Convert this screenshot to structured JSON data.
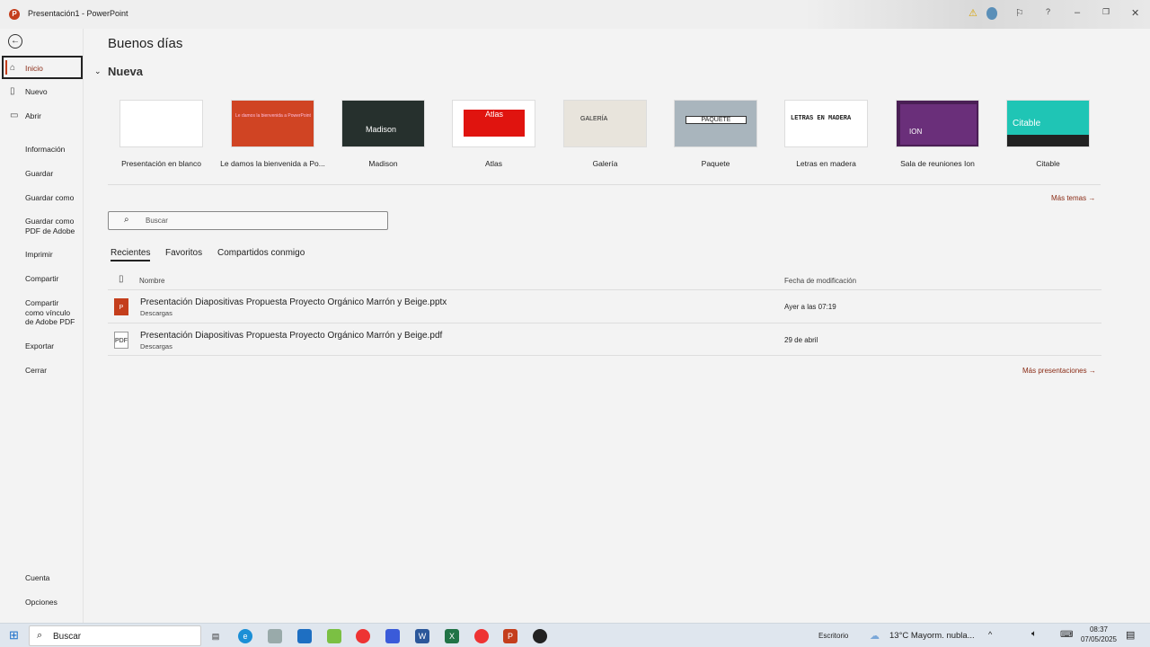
{
  "window": {
    "title": "Presentación1  -  PowerPoint"
  },
  "sidebar": {
    "items": [
      {
        "label": "Inicio",
        "icon": "home-icon"
      },
      {
        "label": "Nuevo",
        "icon": "new-file-icon"
      },
      {
        "label": "Abrir",
        "icon": "folder-open-icon"
      },
      {
        "label": "Información"
      },
      {
        "label": "Guardar"
      },
      {
        "label": "Guardar como"
      },
      {
        "label": "Guardar como PDF de Adobe"
      },
      {
        "label": "Imprimir"
      },
      {
        "label": "Compartir"
      },
      {
        "label": "Compartir como vínculo de Adobe PDF"
      },
      {
        "label": "Exportar"
      },
      {
        "label": "Cerrar"
      }
    ],
    "bottom": [
      {
        "label": "Cuenta"
      },
      {
        "label": "Opciones"
      }
    ]
  },
  "main": {
    "greeting": "Buenos días",
    "new_heading": "Nueva",
    "templates": [
      {
        "label": "Presentación en blanco",
        "bg": "#ffffff",
        "text": ""
      },
      {
        "label": "Le damos la bienvenida a Po...",
        "bg": "#d04423",
        "text": "Le damos la bienvenida a PowerPoint"
      },
      {
        "label": "Madison",
        "bg": "#26302d",
        "text": "Madison"
      },
      {
        "label": "Atlas",
        "bg": "#ffffff",
        "text": "Atlas"
      },
      {
        "label": "Galería",
        "bg": "#e8e4dc",
        "text": "GALERÍA"
      },
      {
        "label": "Paquete",
        "bg": "#a9b5bd",
        "text": "PAQUETE"
      },
      {
        "label": "Letras en madera",
        "bg": "#ffffff",
        "text": "LETRAS EN MADERA"
      },
      {
        "label": "Sala de reuniones Ion",
        "bg": "#4a1f55",
        "text": "ION"
      },
      {
        "label": "Citable",
        "bg": "#1fc5b5",
        "text": "Citable"
      }
    ],
    "more_themes": "Más temas →",
    "search_placeholder": "Buscar",
    "tabs": [
      "Recientes",
      "Favoritos",
      "Compartidos conmigo"
    ],
    "columns": {
      "name": "Nombre",
      "date": "Fecha de modificación"
    },
    "files": [
      {
        "name": "Presentación Diapositivas Propuesta Proyecto Orgánico Marrón y Beige.pptx",
        "location": "Descargas",
        "date": "Ayer a las 07:19",
        "type": "P"
      },
      {
        "name": "Presentación Diapositivas Propuesta Proyecto Orgánico Marrón y Beige.pdf",
        "location": "Descargas",
        "date": "29 de abril",
        "type": "PDF"
      }
    ],
    "more_presentations": "Más presentaciones →"
  },
  "taskbar": {
    "search": "Buscar",
    "desktop": "Escritorio",
    "weather": "13°C  Mayorm. nubla...",
    "time": "08:37",
    "date": "07/05/2025"
  }
}
